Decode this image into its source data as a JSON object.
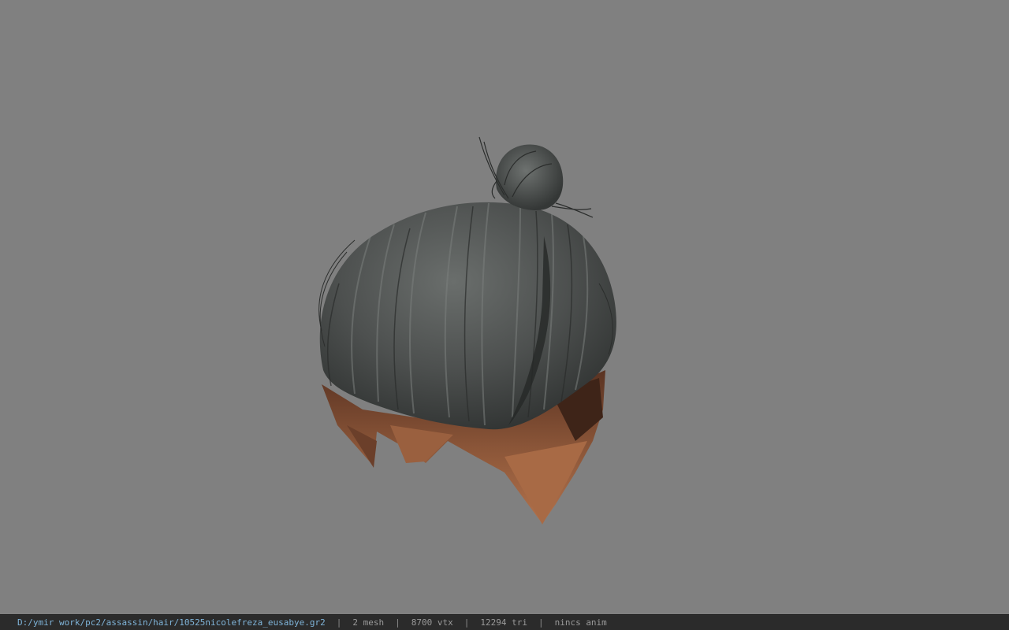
{
  "viewer": {
    "background_color": "#808080",
    "model": {
      "icon": "hair-mesh-icon",
      "hair_color": "#4a4d4c",
      "skin_color": "#8a5538"
    }
  },
  "status_bar": {
    "file_path": "D:/ymir work/pc2/assassin/hair/10525nicolefreza_eusabye.gr2",
    "separator": "|",
    "mesh_count": "2 mesh",
    "vertex_count": "8700 vtx",
    "triangle_count": "12294 tri",
    "animation": "nincs anim"
  }
}
